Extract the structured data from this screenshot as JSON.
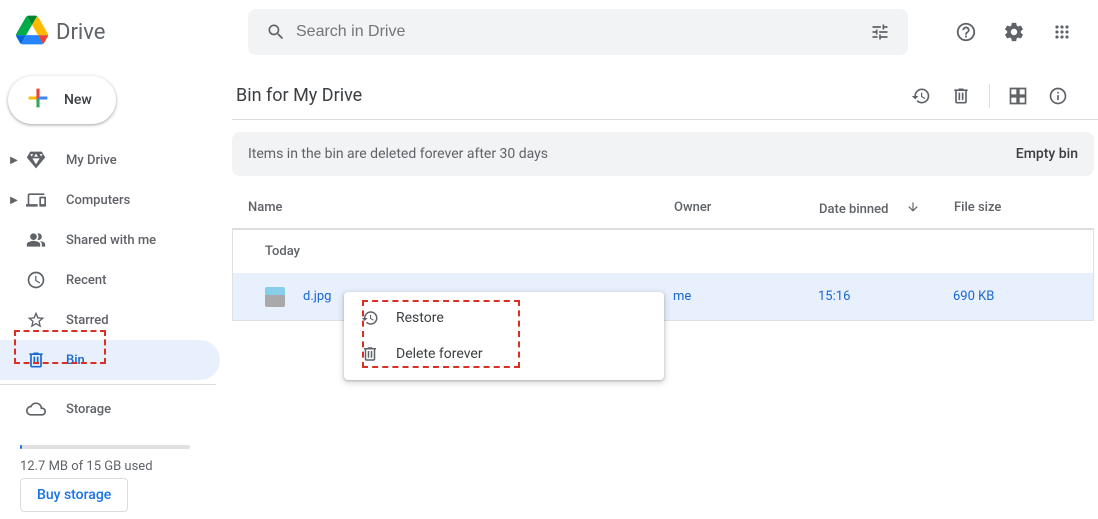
{
  "app": {
    "name": "Drive"
  },
  "search": {
    "placeholder": "Search in Drive"
  },
  "new_button": {
    "label": "New"
  },
  "sidebar": {
    "items": [
      {
        "label": "My Drive"
      },
      {
        "label": "Computers"
      },
      {
        "label": "Shared with me"
      },
      {
        "label": "Recent"
      },
      {
        "label": "Starred"
      },
      {
        "label": "Bin"
      },
      {
        "label": "Storage"
      }
    ]
  },
  "storage": {
    "text": "12.7 MB of 15 GB used",
    "buy": "Buy storage"
  },
  "page": {
    "title": "Bin for My Drive"
  },
  "banner": {
    "text": "Items in the bin are deleted forever after 30 days",
    "action": "Empty bin"
  },
  "columns": {
    "name": "Name",
    "owner": "Owner",
    "date": "Date binned",
    "size": "File size"
  },
  "group": {
    "label": "Today"
  },
  "files": [
    {
      "name": "d.jpg",
      "owner": "me",
      "date": "15:16",
      "size": "690 KB"
    }
  ],
  "context_menu": {
    "restore": "Restore",
    "delete_forever": "Delete forever"
  }
}
